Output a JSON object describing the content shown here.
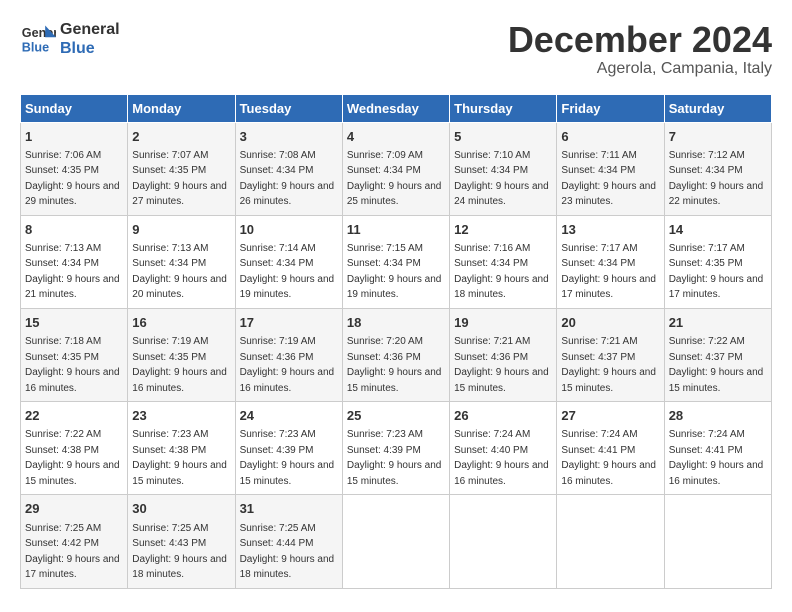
{
  "logo": {
    "line1": "General",
    "line2": "Blue"
  },
  "title": "December 2024",
  "subtitle": "Agerola, Campania, Italy",
  "days_header": [
    "Sunday",
    "Monday",
    "Tuesday",
    "Wednesday",
    "Thursday",
    "Friday",
    "Saturday"
  ],
  "weeks": [
    [
      {
        "day": "1",
        "sunrise": "7:06 AM",
        "sunset": "4:35 PM",
        "daylight": "9 hours and 29 minutes."
      },
      {
        "day": "2",
        "sunrise": "7:07 AM",
        "sunset": "4:35 PM",
        "daylight": "9 hours and 27 minutes."
      },
      {
        "day": "3",
        "sunrise": "7:08 AM",
        "sunset": "4:34 PM",
        "daylight": "9 hours and 26 minutes."
      },
      {
        "day": "4",
        "sunrise": "7:09 AM",
        "sunset": "4:34 PM",
        "daylight": "9 hours and 25 minutes."
      },
      {
        "day": "5",
        "sunrise": "7:10 AM",
        "sunset": "4:34 PM",
        "daylight": "9 hours and 24 minutes."
      },
      {
        "day": "6",
        "sunrise": "7:11 AM",
        "sunset": "4:34 PM",
        "daylight": "9 hours and 23 minutes."
      },
      {
        "day": "7",
        "sunrise": "7:12 AM",
        "sunset": "4:34 PM",
        "daylight": "9 hours and 22 minutes."
      }
    ],
    [
      {
        "day": "8",
        "sunrise": "7:13 AM",
        "sunset": "4:34 PM",
        "daylight": "9 hours and 21 minutes."
      },
      {
        "day": "9",
        "sunrise": "7:13 AM",
        "sunset": "4:34 PM",
        "daylight": "9 hours and 20 minutes."
      },
      {
        "day": "10",
        "sunrise": "7:14 AM",
        "sunset": "4:34 PM",
        "daylight": "9 hours and 19 minutes."
      },
      {
        "day": "11",
        "sunrise": "7:15 AM",
        "sunset": "4:34 PM",
        "daylight": "9 hours and 19 minutes."
      },
      {
        "day": "12",
        "sunrise": "7:16 AM",
        "sunset": "4:34 PM",
        "daylight": "9 hours and 18 minutes."
      },
      {
        "day": "13",
        "sunrise": "7:17 AM",
        "sunset": "4:34 PM",
        "daylight": "9 hours and 17 minutes."
      },
      {
        "day": "14",
        "sunrise": "7:17 AM",
        "sunset": "4:35 PM",
        "daylight": "9 hours and 17 minutes."
      }
    ],
    [
      {
        "day": "15",
        "sunrise": "7:18 AM",
        "sunset": "4:35 PM",
        "daylight": "9 hours and 16 minutes."
      },
      {
        "day": "16",
        "sunrise": "7:19 AM",
        "sunset": "4:35 PM",
        "daylight": "9 hours and 16 minutes."
      },
      {
        "day": "17",
        "sunrise": "7:19 AM",
        "sunset": "4:36 PM",
        "daylight": "9 hours and 16 minutes."
      },
      {
        "day": "18",
        "sunrise": "7:20 AM",
        "sunset": "4:36 PM",
        "daylight": "9 hours and 15 minutes."
      },
      {
        "day": "19",
        "sunrise": "7:21 AM",
        "sunset": "4:36 PM",
        "daylight": "9 hours and 15 minutes."
      },
      {
        "day": "20",
        "sunrise": "7:21 AM",
        "sunset": "4:37 PM",
        "daylight": "9 hours and 15 minutes."
      },
      {
        "day": "21",
        "sunrise": "7:22 AM",
        "sunset": "4:37 PM",
        "daylight": "9 hours and 15 minutes."
      }
    ],
    [
      {
        "day": "22",
        "sunrise": "7:22 AM",
        "sunset": "4:38 PM",
        "daylight": "9 hours and 15 minutes."
      },
      {
        "day": "23",
        "sunrise": "7:23 AM",
        "sunset": "4:38 PM",
        "daylight": "9 hours and 15 minutes."
      },
      {
        "day": "24",
        "sunrise": "7:23 AM",
        "sunset": "4:39 PM",
        "daylight": "9 hours and 15 minutes."
      },
      {
        "day": "25",
        "sunrise": "7:23 AM",
        "sunset": "4:39 PM",
        "daylight": "9 hours and 15 minutes."
      },
      {
        "day": "26",
        "sunrise": "7:24 AM",
        "sunset": "4:40 PM",
        "daylight": "9 hours and 16 minutes."
      },
      {
        "day": "27",
        "sunrise": "7:24 AM",
        "sunset": "4:41 PM",
        "daylight": "9 hours and 16 minutes."
      },
      {
        "day": "28",
        "sunrise": "7:24 AM",
        "sunset": "4:41 PM",
        "daylight": "9 hours and 16 minutes."
      }
    ],
    [
      {
        "day": "29",
        "sunrise": "7:25 AM",
        "sunset": "4:42 PM",
        "daylight": "9 hours and 17 minutes."
      },
      {
        "day": "30",
        "sunrise": "7:25 AM",
        "sunset": "4:43 PM",
        "daylight": "9 hours and 18 minutes."
      },
      {
        "day": "31",
        "sunrise": "7:25 AM",
        "sunset": "4:44 PM",
        "daylight": "9 hours and 18 minutes."
      },
      null,
      null,
      null,
      null
    ]
  ],
  "labels": {
    "sunrise": "Sunrise:",
    "sunset": "Sunset:",
    "daylight": "Daylight:"
  }
}
